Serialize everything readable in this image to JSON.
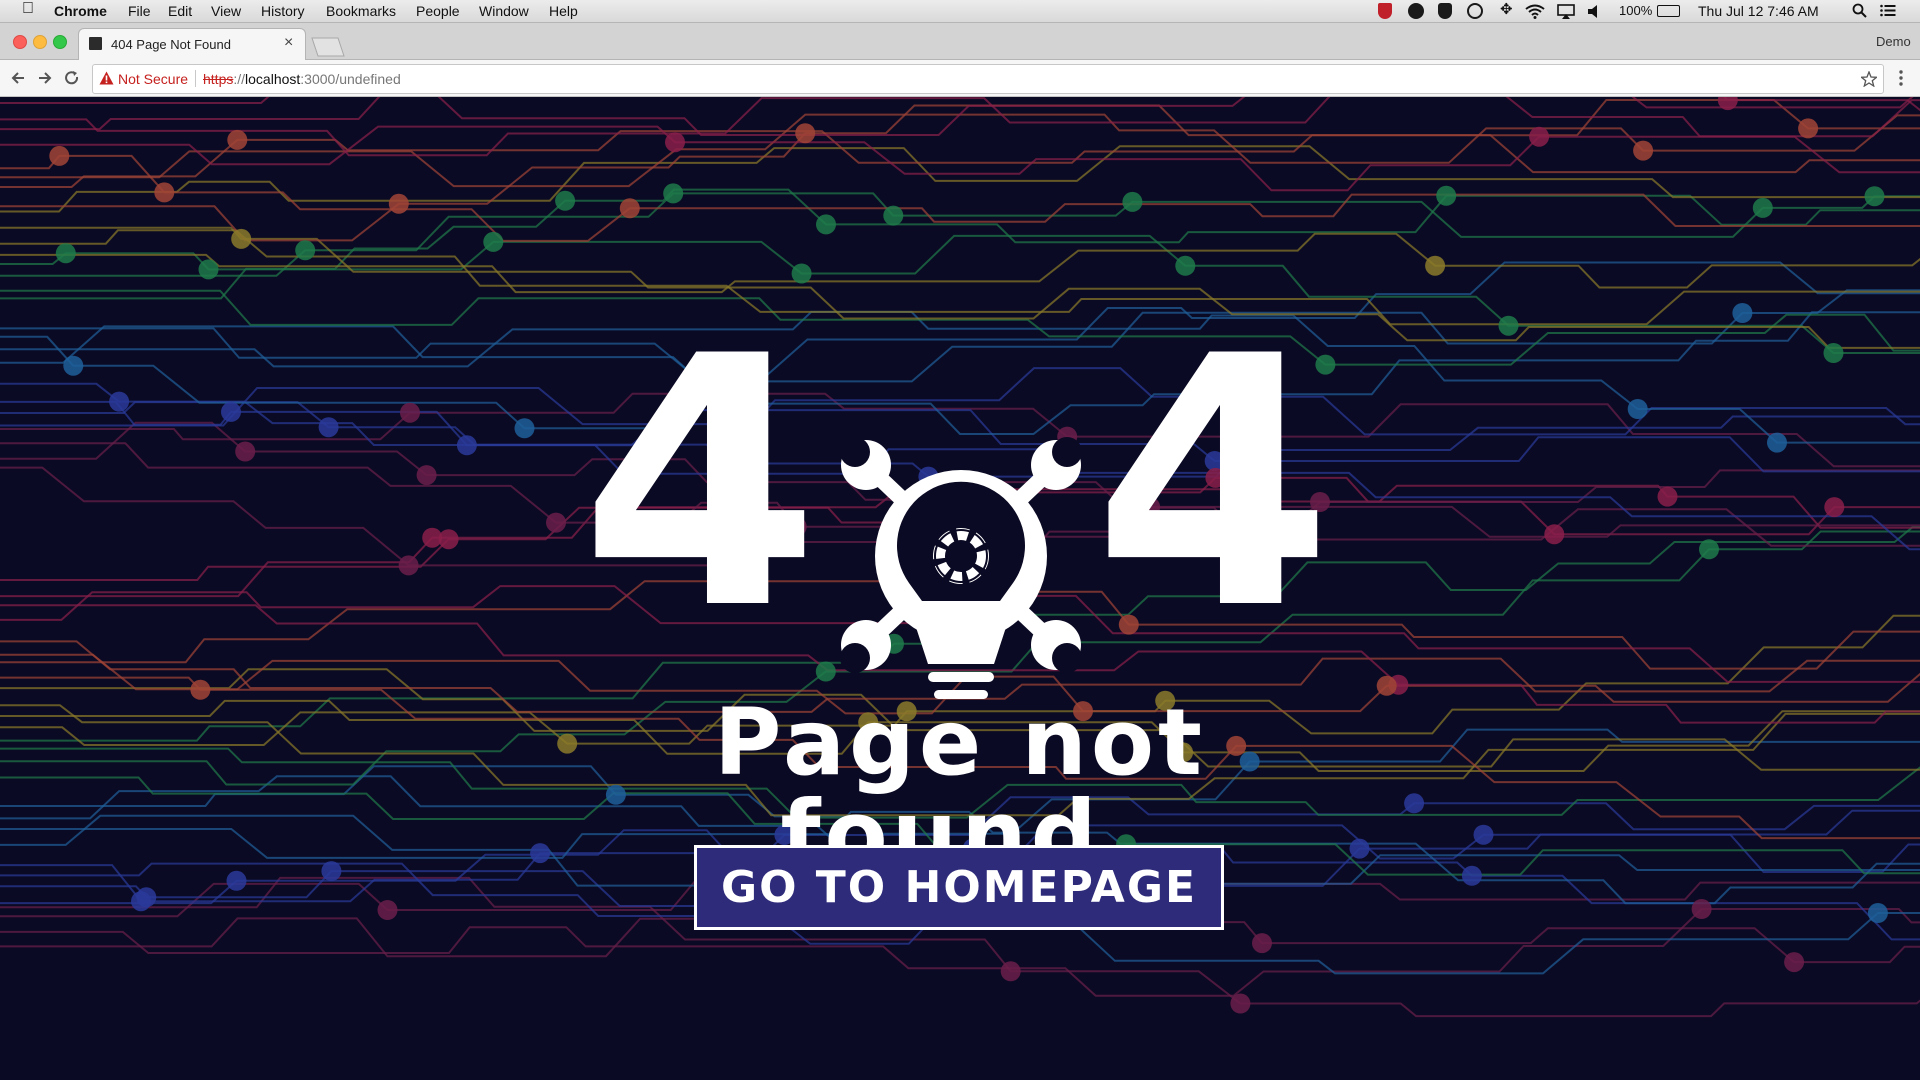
{
  "menubar": {
    "app_name": "Chrome",
    "menus": [
      "File",
      "Edit",
      "View",
      "History",
      "Bookmarks",
      "People",
      "Window",
      "Help"
    ],
    "battery": "100%",
    "clock": "Thu Jul 12  7:46 AM"
  },
  "browser": {
    "tab_title": "404 Page Not Found",
    "profile": "Demo",
    "security_label": "Not Secure",
    "url_scheme": "https",
    "url_separator": "://",
    "url_host": "localhost",
    "url_rest": ":3000/undefined"
  },
  "page": {
    "code_left": "4",
    "code_right": "4",
    "message": "Page not found.",
    "cta_label": "GO TO HOMEPAGE"
  },
  "colors": {
    "background": "#0b0a24",
    "button_fill": "#2e2b7a",
    "circuit_bands": [
      "#8a1f4a",
      "#a14436",
      "#8a7a2a",
      "#1f7a4a",
      "#1f5f9a",
      "#2a3a9a",
      "#6a1f4a"
    ]
  }
}
